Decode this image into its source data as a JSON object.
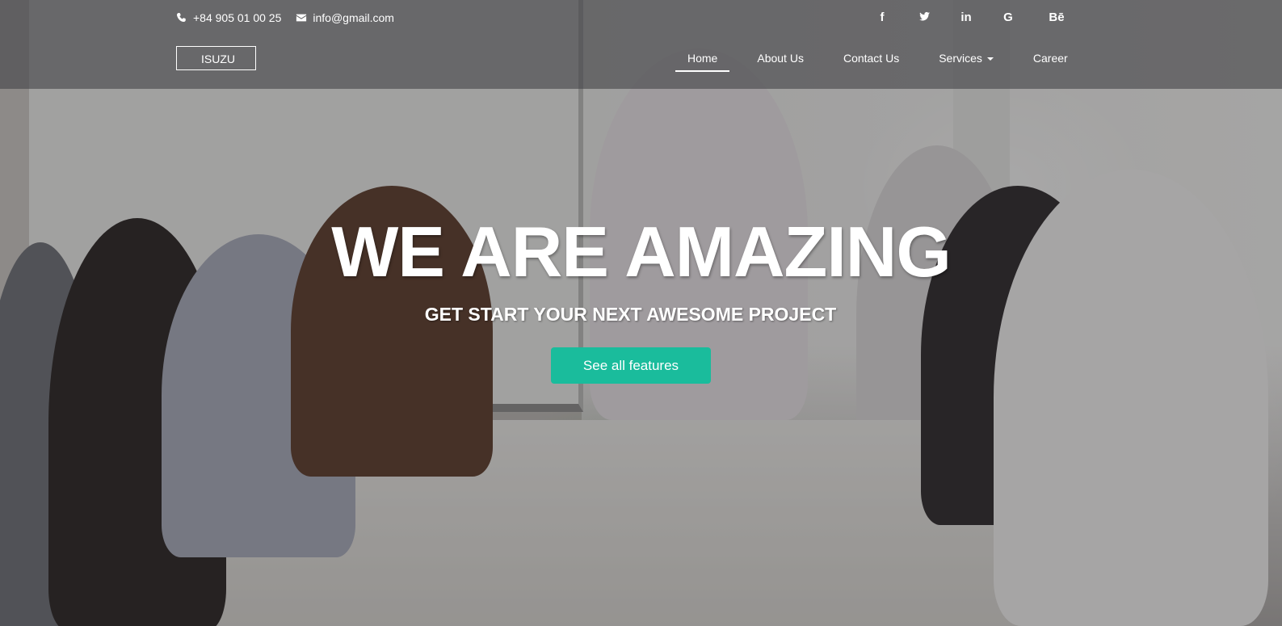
{
  "contact": {
    "phone": "+84 905 01 00 25",
    "phone_icon": "phone-icon",
    "email": "info@gmail.com",
    "email_icon": "envelope-icon"
  },
  "social": [
    {
      "label": "f",
      "icon": "facebook-icon"
    },
    {
      "label": "🐦",
      "icon": "twitter-icon"
    },
    {
      "label": "in",
      "icon": "linkedin-icon"
    },
    {
      "label": "G",
      "icon": "google-icon"
    },
    {
      "label": "Bē",
      "icon": "behance-icon"
    }
  ],
  "brand": {
    "logo_text": "ISUZU"
  },
  "nav": {
    "items": [
      {
        "label": "Home",
        "active": true
      },
      {
        "label": "About Us"
      },
      {
        "label": "Contact Us"
      },
      {
        "label": "Services",
        "has_dropdown": true
      },
      {
        "label": "Career"
      }
    ]
  },
  "hero": {
    "headline": "WE ARE AMAZING",
    "subheadline": "GET START YOUR NEXT AWESOME PROJECT",
    "cta_label": "See all features"
  },
  "colors": {
    "accent": "#1abc9c",
    "header_bg": "rgba(70,70,72,0.62)",
    "text": "#ffffff"
  }
}
